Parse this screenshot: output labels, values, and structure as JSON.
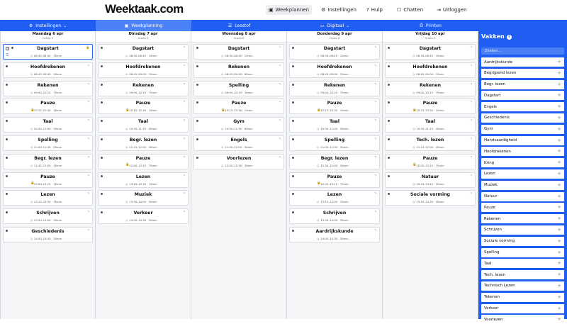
{
  "topbar": {
    "logo": "Weektaak.com",
    "nav": [
      {
        "name": "weekplannen",
        "icon": "calendar-icon",
        "glyph": "▣",
        "label": "Weekplannen",
        "active": true
      },
      {
        "name": "instellingen",
        "icon": "sliders-icon",
        "glyph": "⚙",
        "label": "Instellingen",
        "active": false
      },
      {
        "name": "hulp",
        "icon": "help-icon",
        "glyph": "?",
        "label": "Hulp",
        "active": false
      },
      {
        "name": "chatten",
        "icon": "chat-icon",
        "glyph": "☐",
        "label": "Chatten",
        "active": false
      },
      {
        "name": "uitloggen",
        "icon": "logout-icon",
        "glyph": "⇥",
        "label": "Uitloggen",
        "active": false
      }
    ]
  },
  "subnav": [
    {
      "name": "instellingen",
      "icon": "sliders-icon",
      "glyph": "⚙",
      "label": "Instellingen",
      "caret": "⌄",
      "active": false
    },
    {
      "name": "weekplanning",
      "icon": "calendar-icon",
      "glyph": "▣",
      "label": "Weekplanning",
      "caret": "",
      "active": true
    },
    {
      "name": "lesstof",
      "icon": "list-icon",
      "glyph": "☰",
      "label": "Lesstof",
      "caret": "",
      "active": false
    },
    {
      "name": "digitaal",
      "icon": "monitor-icon",
      "glyph": "▭",
      "label": "Digitaal",
      "caret": "⌄",
      "active": false
    },
    {
      "name": "printen",
      "icon": "printer-icon",
      "glyph": "⎙",
      "label": "Printen",
      "caret": "",
      "active": false
    }
  ],
  "days": [
    {
      "name": "Maandag 6 apr",
      "group": "Groep 6",
      "items": [
        {
          "title": "Dagstart",
          "time": "08:30–08:45 · 15min",
          "selected": true
        },
        {
          "title": "Hoofdrekenen",
          "time": "08:45–09:00 · 15min"
        },
        {
          "title": "Rekenen",
          "time": "09:00–10:15 · 75min"
        },
        {
          "title": "Pauze",
          "time": "10:15–10:30 · 15min",
          "pause": true
        },
        {
          "title": "Taal",
          "time": "10:30–11:00 · 30min"
        },
        {
          "title": "Spelling",
          "time": "11:00–11:45 · 45min"
        },
        {
          "title": "Begr. lezen",
          "time": "11:45–12:00 · 15min"
        },
        {
          "title": "Pauze",
          "time": "12:00–13:15 · 75min",
          "pause": true
        },
        {
          "title": "Lezen",
          "time": "13:15–13:30 · 15min"
        },
        {
          "title": "Schrijven",
          "time": "13:30–14:00 · 30min"
        },
        {
          "title": "Geschiedenis",
          "time": "14:00–14:30 · 30min"
        }
      ]
    },
    {
      "name": "Dinsdag 7 apr",
      "group": "Groep 6",
      "items": [
        {
          "title": "Dagstart",
          "time": "08:30–08:45 · 15min"
        },
        {
          "title": "Hoofdrekenen",
          "time": "08:45–09:00 · 15min"
        },
        {
          "title": "Rekenen",
          "time": "09:00–10:15 · 75min"
        },
        {
          "title": "Pauze",
          "time": "10:15–10:30 · 15min",
          "pause": true
        },
        {
          "title": "Taal",
          "time": "10:30–11:15 · 45min"
        },
        {
          "title": "Begr. lezen",
          "time": "11:15–12:00 · 45min"
        },
        {
          "title": "Pauze",
          "time": "12:00–13:15 · 75min",
          "pause": true
        },
        {
          "title": "Lezen",
          "time": "13:15–13:30 · 15min"
        },
        {
          "title": "Muziek",
          "time": "13:30–14:00 · 30min"
        },
        {
          "title": "Verkeer",
          "time": "14:00–14:30 · 30min"
        }
      ]
    },
    {
      "name": "Woensdag 8 apr",
      "group": "Groep 6",
      "items": [
        {
          "title": "Dagstart",
          "time": "08:30–08:45 · 15min"
        },
        {
          "title": "Rekenen",
          "time": "08:45–09:45 · 60min"
        },
        {
          "title": "Spelling",
          "time": "09:45–10:15 · 30min"
        },
        {
          "title": "Pauze",
          "time": "10:15–10:30 · 15min",
          "pause": true
        },
        {
          "title": "Gym",
          "time": "10:30–11:30 · 60min"
        },
        {
          "title": "Engels",
          "time": "11:30–12:00 · 30min"
        },
        {
          "title": "Voorlezen",
          "time": "12:00–12:30 · 30min"
        }
      ]
    },
    {
      "name": "Donderdag 9 apr",
      "group": "Groep 6",
      "items": [
        {
          "title": "Dagstart",
          "time": "08:30–08:45 · 15min"
        },
        {
          "title": "Hoofdrekenen",
          "time": "08:45–09:00 · 15min"
        },
        {
          "title": "Rekenen",
          "time": "09:00–10:15 · 75min"
        },
        {
          "title": "Pauze",
          "time": "10:15–10:30 · 15min",
          "pause": true
        },
        {
          "title": "Taal",
          "time": "10:30–11:00 · 30min"
        },
        {
          "title": "Spelling",
          "time": "11:00–11:30 · 30min"
        },
        {
          "title": "Begr. lezen",
          "time": "11:30–12:00 · 30min"
        },
        {
          "title": "Pauze",
          "time": "12:00–13:15 · 75min",
          "pause": true
        },
        {
          "title": "Lezen",
          "time": "13:15–13:30 · 15min"
        },
        {
          "title": "Schrijven",
          "time": "13:30–14:00 · 30min"
        },
        {
          "title": "Aardrijkskunde",
          "time": "14:00–14:30 · 30min"
        }
      ]
    },
    {
      "name": "Vrijdag 10 apr",
      "group": "Groep 6",
      "items": [
        {
          "title": "Dagstart",
          "time": "08:30–08:45 · 15min"
        },
        {
          "title": "Hoofdrekenen",
          "time": "08:45–09:00 · 15min"
        },
        {
          "title": "Rekenen",
          "time": "09:00–10:15 · 75min"
        },
        {
          "title": "Pauze",
          "time": "10:15–10:30 · 15min",
          "pause": true
        },
        {
          "title": "Taal",
          "time": "10:30–11:15 · 45min"
        },
        {
          "title": "Tech. lezen",
          "time": "11:15–12:00 · 45min"
        },
        {
          "title": "Pauze",
          "time": "12:00–13:15 · 75min",
          "pause": true
        },
        {
          "title": "Natuur",
          "time": "13:15–13:45 · 30min"
        },
        {
          "title": "Sociale vorming",
          "time": "13:45–14:30 · 45min"
        }
      ]
    }
  ],
  "panel": {
    "title": "Vakken",
    "info": "i",
    "search_placeholder": "Zoeken...",
    "vakken": [
      "Aardrijkskunde",
      "Begrijpend lezen",
      "Begr. lezen",
      "Dagstart",
      "Engels",
      "Geschiedenis",
      "Gym",
      "Handvaardigheid",
      "Hoofdrekenen",
      "Kring",
      "Lezen",
      "Muziek",
      "Natuur",
      "Pauze",
      "Rekenen",
      "Schrijven",
      "Sociale vorming",
      "Spelling",
      "Taal",
      "Tech. lezen",
      "Technisch Lezen",
      "Tekenen",
      "Verkeer",
      "Voorlezen"
    ]
  },
  "colors": {
    "brand": "#1f5ef0",
    "active_tab": "#4b82f7",
    "lock": "#e1a400"
  }
}
